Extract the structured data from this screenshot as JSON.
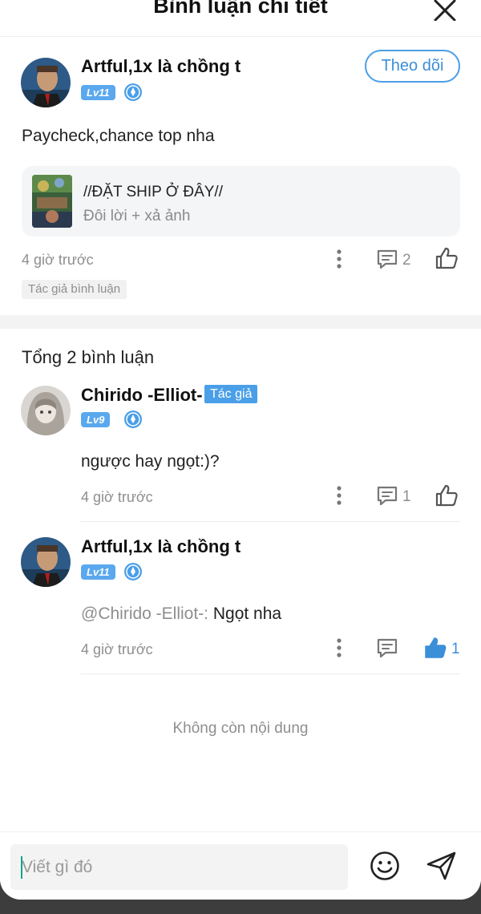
{
  "header": {
    "title": "Bình luận chi tiết"
  },
  "main_comment": {
    "username": "Artful,1x là chồng t",
    "level": "Lv11",
    "follow_label": "Theo dõi",
    "text": "Paycheck,chance top nha",
    "card": {
      "title": "//ĐẶT SHIP Ở ĐÂY//",
      "subtitle": "Đôi lời + xả ảnh"
    },
    "time": "4 giờ trước",
    "reply_count": "2",
    "tag": "Tác giả bình luận"
  },
  "replies_header": {
    "total": "Tổng 2 bình luận"
  },
  "replies": [
    {
      "username": "Chirido -Elliot-",
      "author_tag": "Tác giả",
      "level": "Lv9",
      "text": "ngược hay ngọt:)?",
      "time": "4 giờ trước",
      "reply_count": "1"
    },
    {
      "username": "Artful,1x là chồng t",
      "level": "Lv11",
      "mention": "@Chirido -Elliot-:",
      "text": " Ngọt nha",
      "time": "4 giờ trước",
      "like_count": "1"
    }
  ],
  "end_text": "Không còn nội dung",
  "composer": {
    "placeholder": "Viết gì đó"
  },
  "colors": {
    "accent": "#4a9fe8",
    "liked": "#3b8fd9"
  },
  "icons": [
    "close-icon",
    "more-icon",
    "reply-icon",
    "like-icon",
    "emoji-icon",
    "send-icon"
  ]
}
